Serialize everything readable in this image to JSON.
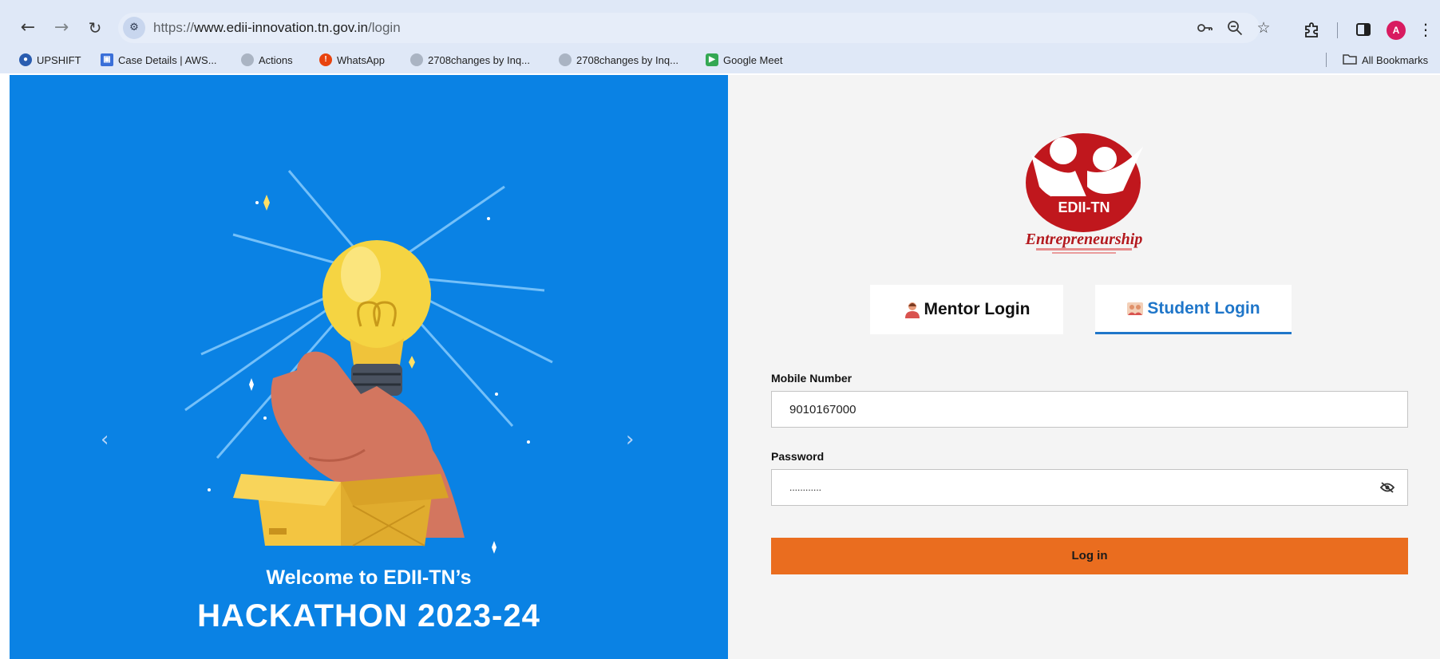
{
  "browser": {
    "url_prefix": "https://",
    "url_host": "www.edii-innovation.tn.gov.in",
    "url_path": "/login",
    "avatar_letter": "A",
    "bookmarks": [
      {
        "label": "UPSHIFT",
        "icon": "upshift-icon",
        "color": "#2a5db0"
      },
      {
        "label": "Case Details | AWS...",
        "icon": "aws-icon",
        "color": "#3a6fd8"
      },
      {
        "label": "Actions",
        "icon": "github-icon",
        "color": "#9aa5b5"
      },
      {
        "label": "WhatsApp",
        "icon": "whatsapp-icon",
        "color": "#e8430e"
      },
      {
        "label": "2708changes by Inq...",
        "icon": "github-icon",
        "color": "#9aa5b5"
      },
      {
        "label": "2708changes by Inq...",
        "icon": "github-icon",
        "color": "#9aa5b5"
      },
      {
        "label": "Google Meet",
        "icon": "google-meet-icon",
        "color": "#34a853"
      }
    ],
    "all_bookmarks": "All Bookmarks"
  },
  "hero": {
    "welcome": "Welcome to EDII-TN’s",
    "title": "HACKATHON 2023-24"
  },
  "logo": {
    "badge": "EDII-TN",
    "script": "Entrepreneurship"
  },
  "tabs": {
    "mentor": "Mentor Login",
    "student": "Student Login",
    "active": "student"
  },
  "form": {
    "mobile_label": "Mobile Number",
    "mobile_value": "9010167000",
    "password_label": "Password",
    "password_value": "............",
    "submit": "Log in"
  },
  "colors": {
    "hero_bg": "#0a82e4",
    "accent": "#1f76c9",
    "button": "#ea6d1f",
    "logo_red": "#c0171d"
  }
}
